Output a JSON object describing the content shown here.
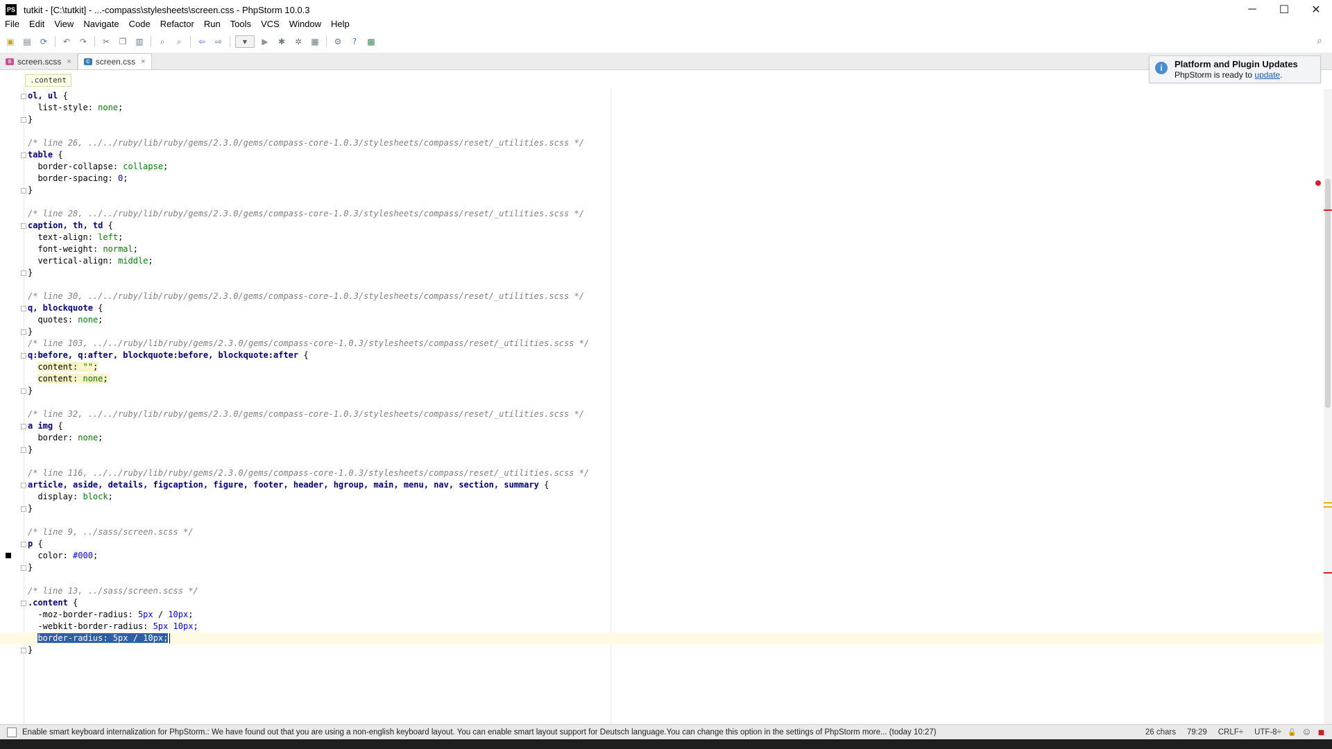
{
  "window": {
    "title": "tutkit - [C:\\tutkit] - ...-compass\\stylesheets\\screen.css - PhpStorm 10.0.3",
    "app_icon_label": "PS",
    "minimize": "─",
    "maximize": "☐",
    "close": "✕"
  },
  "menu": [
    "File",
    "Edit",
    "View",
    "Navigate",
    "Code",
    "Refactor",
    "Run",
    "Tools",
    "VCS",
    "Window",
    "Help"
  ],
  "tabs": [
    {
      "label": "screen.scss",
      "type": "scss",
      "active": false
    },
    {
      "label": "screen.css",
      "type": "css",
      "active": true
    }
  ],
  "tab_close_glyph": "×",
  "breadcrumb": ".content",
  "notification": {
    "title": "Platform and Plugin Updates",
    "body": "PhpStorm is ready to ",
    "link": "update",
    "suffix": ".",
    "icon": "i"
  },
  "code_lines": [
    "ol, ul {",
    "  list-style: none;",
    "}",
    "",
    "/* line 26, ../../ruby/lib/ruby/gems/2.3.0/gems/compass-core-1.0.3/stylesheets/compass/reset/_utilities.scss */",
    "table {",
    "  border-collapse: collapse;",
    "  border-spacing: 0;",
    "}",
    "",
    "/* line 28, ../../ruby/lib/ruby/gems/2.3.0/gems/compass-core-1.0.3/stylesheets/compass/reset/_utilities.scss */",
    "caption, th, td {",
    "  text-align: left;",
    "  font-weight: normal;",
    "  vertical-align: middle;",
    "}",
    "",
    "/* line 30, ../../ruby/lib/ruby/gems/2.3.0/gems/compass-core-1.0.3/stylesheets/compass/reset/_utilities.scss */",
    "q, blockquote {",
    "  quotes: none;",
    "}",
    "/* line 103, ../../ruby/lib/ruby/gems/2.3.0/gems/compass-core-1.0.3/stylesheets/compass/reset/_utilities.scss */",
    "q:before, q:after, blockquote:before, blockquote:after {",
    "  content: \"\";",
    "  content: none;",
    "}",
    "",
    "/* line 32, ../../ruby/lib/ruby/gems/2.3.0/gems/compass-core-1.0.3/stylesheets/compass/reset/_utilities.scss */",
    "a img {",
    "  border: none;",
    "}",
    "",
    "/* line 116, ../../ruby/lib/ruby/gems/2.3.0/gems/compass-core-1.0.3/stylesheets/compass/reset/_utilities.scss */",
    "article, aside, details, figcaption, figure, footer, header, hgroup, main, menu, nav, section, summary {",
    "  display: block;",
    "}",
    "",
    "/* line 9, ../sass/screen.scss */",
    "p {",
    "  color: #000;",
    "}",
    "",
    "/* line 13, ../sass/screen.scss */",
    ".content {",
    "  -moz-border-radius: 5px / 10px;",
    "  -webkit-border-radius: 5px 10px;",
    "  border-radius: 5px / 10px;",
    "}"
  ],
  "status": {
    "message": "Enable smart keyboard internalization for PhpStorm.: We have found out that you are using a non-english keyboard layout. You can enable smart layout support for Deutsch language.You can change this option in the settings of PhpStorm more... (today 10:27)",
    "chars": "26 chars",
    "position": "79:29",
    "line_ending": "CRLF÷",
    "encoding": "UTF-8÷"
  },
  "colors": {
    "selection": "#2e5ea8",
    "error_marker": "#d11e2a",
    "warning_marker": "#e2b400"
  }
}
